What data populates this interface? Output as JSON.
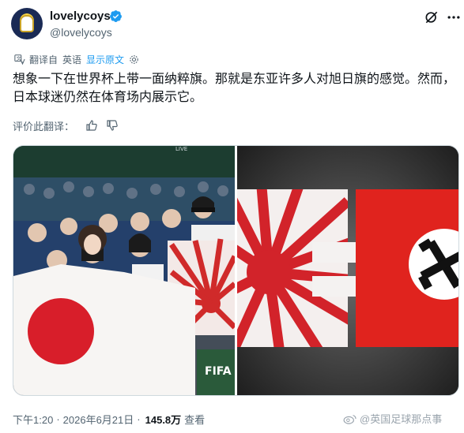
{
  "author": {
    "display_name": "lovelycoys",
    "handle": "@lovelycoys",
    "verified_color": "#1d9bf0"
  },
  "translation_bar": {
    "label": "翻译自",
    "language": "英语",
    "show_original": "显示原文"
  },
  "tweet": {
    "text": "想象一下在世界杯上带一面纳粹旗。那就是东亚许多人对旭日旗的感觉。然而，日本球迷仍然在体育场内展示它。"
  },
  "rate_translation": {
    "label": "评价此翻译："
  },
  "media": {
    "left_overlay_text": "LIVE",
    "left_side_text": "FIFA",
    "right_description_hidden": true
  },
  "footer": {
    "time": "下午1:20",
    "separator": "·",
    "date": "2026年6月21日",
    "views": "145.8万",
    "views_label": "查看"
  },
  "watermark": {
    "text": "@英国足球那点事"
  },
  "colors": {
    "accent": "#1d9bf0",
    "text_primary": "#0f1419",
    "text_secondary": "#536471"
  }
}
